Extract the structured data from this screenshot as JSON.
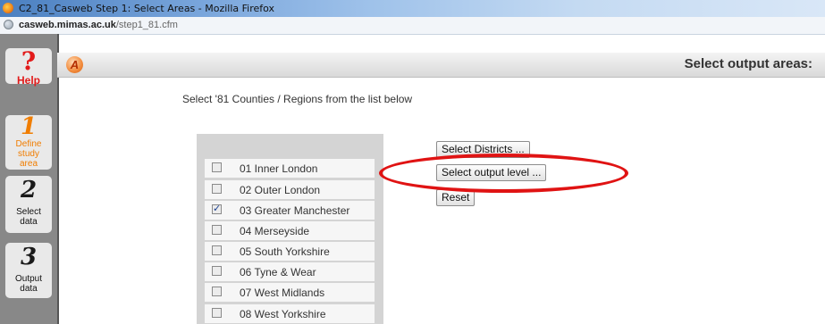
{
  "window": {
    "title": "C2_81_Casweb Step 1: Select Areas - Mozilla Firefox",
    "url_domain": "casweb.mimas.ac.uk",
    "url_path": "/step1_81.cfm"
  },
  "sidebar": {
    "help": {
      "symbol": "?",
      "label": "Help"
    },
    "steps": [
      {
        "number": "1",
        "label_line1": "Define",
        "label_line2": "study",
        "label_line3": "area"
      },
      {
        "number": "2",
        "label_line1": "Select",
        "label_line2": "data"
      },
      {
        "number": "3",
        "label_line1": "Output",
        "label_line2": "data"
      }
    ]
  },
  "header": {
    "logo": "A",
    "title": "Select output areas:"
  },
  "instruction": "Select '81 Counties / Regions from the list below",
  "areas": [
    {
      "label": "01 Inner London",
      "checked": false
    },
    {
      "label": "02 Outer London",
      "checked": false
    },
    {
      "label": "03 Greater Manchester",
      "checked": true
    },
    {
      "label": "04 Merseyside",
      "checked": false
    },
    {
      "label": "05 South Yorkshire",
      "checked": false
    },
    {
      "label": "06 Tyne & Wear",
      "checked": false
    },
    {
      "label": "07 West Midlands",
      "checked": false
    },
    {
      "label": "08 West Yorkshire",
      "checked": false
    }
  ],
  "buttons": {
    "select_districts": "Select Districts ...",
    "select_output_level": "Select output level ...",
    "reset": "Reset"
  },
  "colors": {
    "annotation": "#e01313",
    "help": "#e21a1a",
    "active_step": "#f07d00"
  }
}
